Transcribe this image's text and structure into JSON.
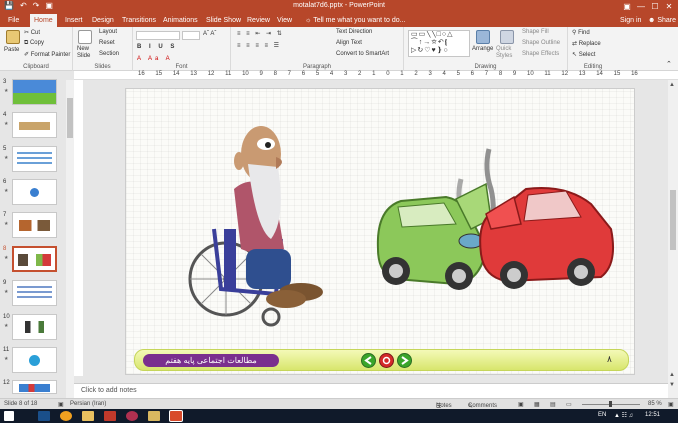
{
  "window": {
    "title": "motalat7d6.pptx - PowerPoint",
    "controls": [
      "—",
      "☐",
      "✕"
    ]
  },
  "qat": [
    "💾",
    "↶",
    "↷",
    "▣"
  ],
  "tabs": [
    "File",
    "Home",
    "Insert",
    "Design",
    "Transitions",
    "Animations",
    "Slide Show",
    "Review",
    "View"
  ],
  "tell_me": "Tell me what you want to do...",
  "sign_in": "Sign in",
  "share": "Share",
  "ribbon": {
    "clipboard": {
      "label": "Clipboard",
      "paste": "Paste",
      "cut": "Cut",
      "copy": "Copy",
      "format_painter": "Format Painter"
    },
    "slides": {
      "label": "Slides",
      "new_slide": "New Slide",
      "layout": "Layout",
      "reset": "Reset",
      "section": "Section"
    },
    "font": {
      "label": "Font"
    },
    "paragraph": {
      "label": "Paragraph",
      "text_direction": "Text Direction",
      "align_text": "Align Text",
      "convert_smartart": "Convert to SmartArt"
    },
    "drawing": {
      "label": "Drawing",
      "arrange": "Arrange",
      "quick_styles": "Quick Styles",
      "shape_fill": "Shape Fill",
      "shape_outline": "Shape Outline",
      "shape_effects": "Shape Effects"
    },
    "editing": {
      "label": "Editing",
      "find": "Find",
      "replace": "Replace",
      "select": "Select"
    }
  },
  "ruler": [
    "16",
    "15",
    "14",
    "13",
    "12",
    "11",
    "10",
    "9",
    "8",
    "7",
    "6",
    "5",
    "4",
    "3",
    "2",
    "1",
    "0",
    "1",
    "2",
    "3",
    "4",
    "5",
    "6",
    "7",
    "8",
    "9",
    "10",
    "11",
    "12",
    "13",
    "14",
    "15",
    "16"
  ],
  "thumbnails": [
    {
      "num": "3",
      "active": false
    },
    {
      "num": "4",
      "active": false
    },
    {
      "num": "5",
      "active": false
    },
    {
      "num": "6",
      "active": false
    },
    {
      "num": "7",
      "active": false
    },
    {
      "num": "8",
      "active": true
    },
    {
      "num": "9",
      "active": false
    },
    {
      "num": "10",
      "active": false
    },
    {
      "num": "11",
      "active": false
    },
    {
      "num": "12",
      "active": false
    }
  ],
  "slide": {
    "banner_text": "مطالعات اجتماعی پایه هفتم",
    "page_number": "۸",
    "colors": {
      "banner_bg": "#7a2f8e",
      "bar": "#d8e66d",
      "nav_green": "#3aa52a",
      "nav_red": "#d42a2a"
    }
  },
  "notes_placeholder": "Click to add notes",
  "status": {
    "slide_info": "Slide 8 of 18",
    "language": "Persian (Iran)",
    "notes": "Notes",
    "comments": "Comments",
    "zoom": "85 %"
  },
  "taskbar": {
    "lang": "EN",
    "time": "12:51"
  }
}
